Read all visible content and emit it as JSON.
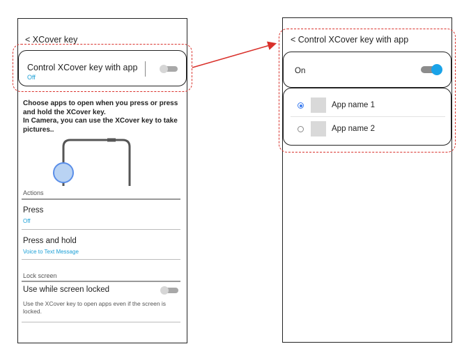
{
  "left": {
    "header": "< XCover key",
    "control_card": {
      "label": "Control XCover key with app",
      "status": "Off"
    },
    "description": "Choose apps to open when you press or press and hold the XCover key.\nIn Camera, you can use the XCover key to take pictures..",
    "actions_header": "Actions",
    "press": {
      "label": "Press",
      "value": "Off"
    },
    "press_hold": {
      "label": "Press and hold",
      "value": "Voice to Text Message"
    },
    "lock_header": "Lock screen",
    "lock": {
      "label": "Use while screen locked",
      "description": "Use the XCover key to open apps even if the screen is locked."
    }
  },
  "right": {
    "header": "< Control XCover key with app",
    "on_card": {
      "label": "On"
    },
    "apps": [
      {
        "label": "App name 1",
        "selected": true
      },
      {
        "label": "App name 2",
        "selected": false
      }
    ]
  },
  "colors": {
    "accent": "#1aa3e8",
    "blue_text": "#1a9fd6",
    "highlight_dash": "#d9312b",
    "radio": "#3b7cf0"
  },
  "icons": [
    "back-chevron",
    "toggle-switch",
    "radio-button",
    "app-placeholder-icon",
    "arrow-annotation",
    "phone-outline-illustration",
    "xcover-key-highlight"
  ]
}
